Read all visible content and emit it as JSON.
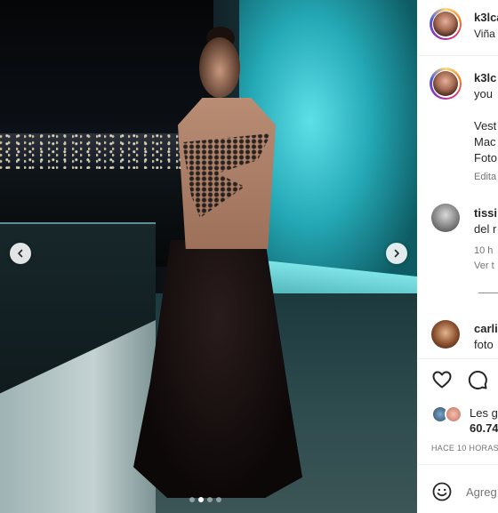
{
  "post": {
    "carousel": {
      "total_slides": 4,
      "active_slide": 2
    }
  },
  "header": {
    "username": "k3lca",
    "location": "Viña d"
  },
  "caption": {
    "username": "k3lc",
    "line1": "you",
    "line2": "Vest",
    "line3": "Mac",
    "line4": "Foto",
    "edited": "Edita"
  },
  "comments": [
    {
      "username": "tissi",
      "text": "del r",
      "time": "10 h",
      "view_replies": "Ver t"
    },
    {
      "username": "carli",
      "text": "foto"
    }
  ],
  "likes": {
    "label": "Les g",
    "count": "60.74"
  },
  "timestamp": "HACE 10 HORAS",
  "add_comment": {
    "placeholder": "Agreg"
  }
}
